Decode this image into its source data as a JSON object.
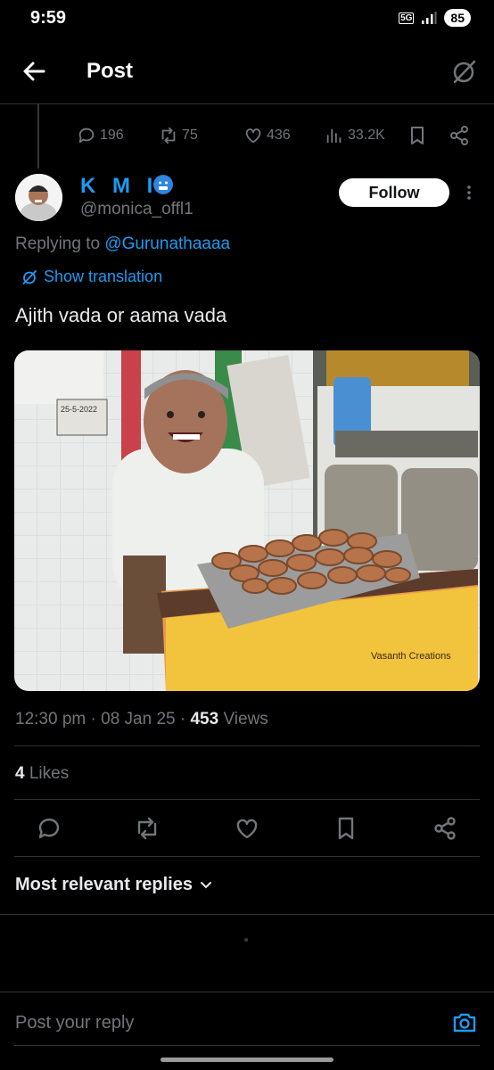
{
  "status_bar": {
    "time": "9:59",
    "network": "5G",
    "battery": "85"
  },
  "header": {
    "title": "Post"
  },
  "parent_stats": {
    "replies": "196",
    "reposts": "75",
    "likes": "436",
    "views": "33.2K"
  },
  "post": {
    "display_name": "K M I",
    "handle": "@monica_offl1",
    "follow_label": "Follow",
    "replying_prefix": "Replying to ",
    "replying_to": "@Gurunathaaaa",
    "show_translation": "Show translation",
    "text": "Ajith vada or aama vada",
    "image_watermark": "Vasanth Creations",
    "image_sign_date": "25-5-2022",
    "time": "12:30 pm",
    "date": "08 Jan 25",
    "views_count": "453",
    "views_label": " Views",
    "likes_count": "4",
    "likes_label": " Likes"
  },
  "replies_section": {
    "sort_label": "Most relevant replies"
  },
  "composer": {
    "placeholder": "Post your reply"
  },
  "icons": [
    "back-arrow-icon",
    "grok-icon",
    "reply-icon",
    "repost-icon",
    "like-icon",
    "views-icon",
    "bookmark-icon",
    "share-icon",
    "more-icon",
    "translate-icon",
    "chevron-down-icon",
    "camera-icon"
  ],
  "colors": {
    "accent": "#1d9bf0",
    "background": "#000000",
    "muted": "#71767b",
    "text": "#e7e9ea"
  }
}
